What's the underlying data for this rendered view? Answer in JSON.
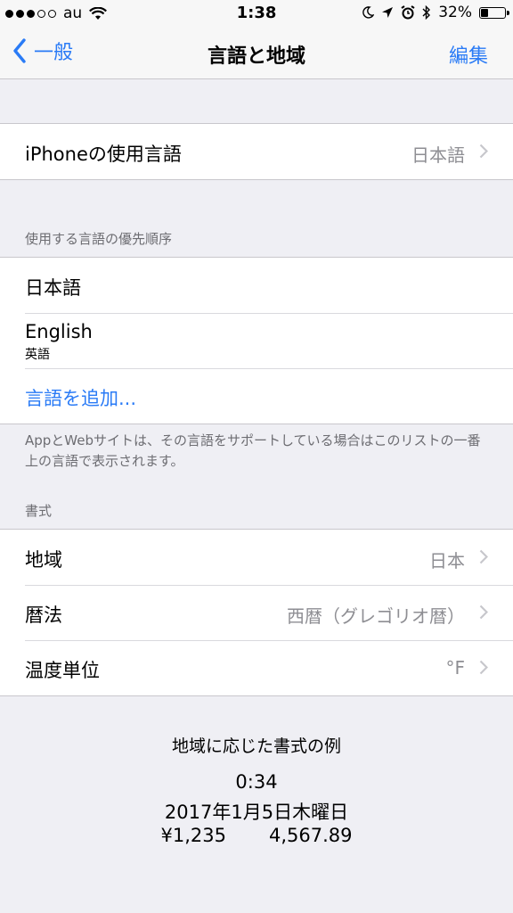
{
  "status": {
    "carrier": "au",
    "time": "1:38",
    "battery": "32%",
    "battery_level": 0.32,
    "signal_filled": 3,
    "signal_total": 5
  },
  "nav": {
    "back": "一般",
    "title": "言語と地域",
    "edit": "編集"
  },
  "iphone_language": {
    "label": "iPhoneの使用言語",
    "value": "日本語"
  },
  "preferred": {
    "header": "使用する言語の優先順序",
    "items": [
      {
        "label": "日本語",
        "sub": ""
      },
      {
        "label": "English",
        "sub": "英語"
      }
    ],
    "add": "言語を追加...",
    "footer": "AppとWebサイトは、その言語をサポートしている場合はこのリストの一番上の言語で表示されます。"
  },
  "format": {
    "header": "書式",
    "rows": [
      {
        "label": "地域",
        "value": "日本"
      },
      {
        "label": "暦法",
        "value": "西暦（グレゴリオ暦）"
      },
      {
        "label": "温度単位",
        "value": "°F"
      }
    ]
  },
  "example": {
    "title": "地域に応じた書式の例",
    "time": "0:34",
    "date": "2017年1月5日木曜日",
    "currency": "¥1,235",
    "number": "4,567.89"
  },
  "colors": {
    "accent": "#2a7bf6",
    "background": "#efeff4",
    "secondary_text": "#8e8e93"
  }
}
